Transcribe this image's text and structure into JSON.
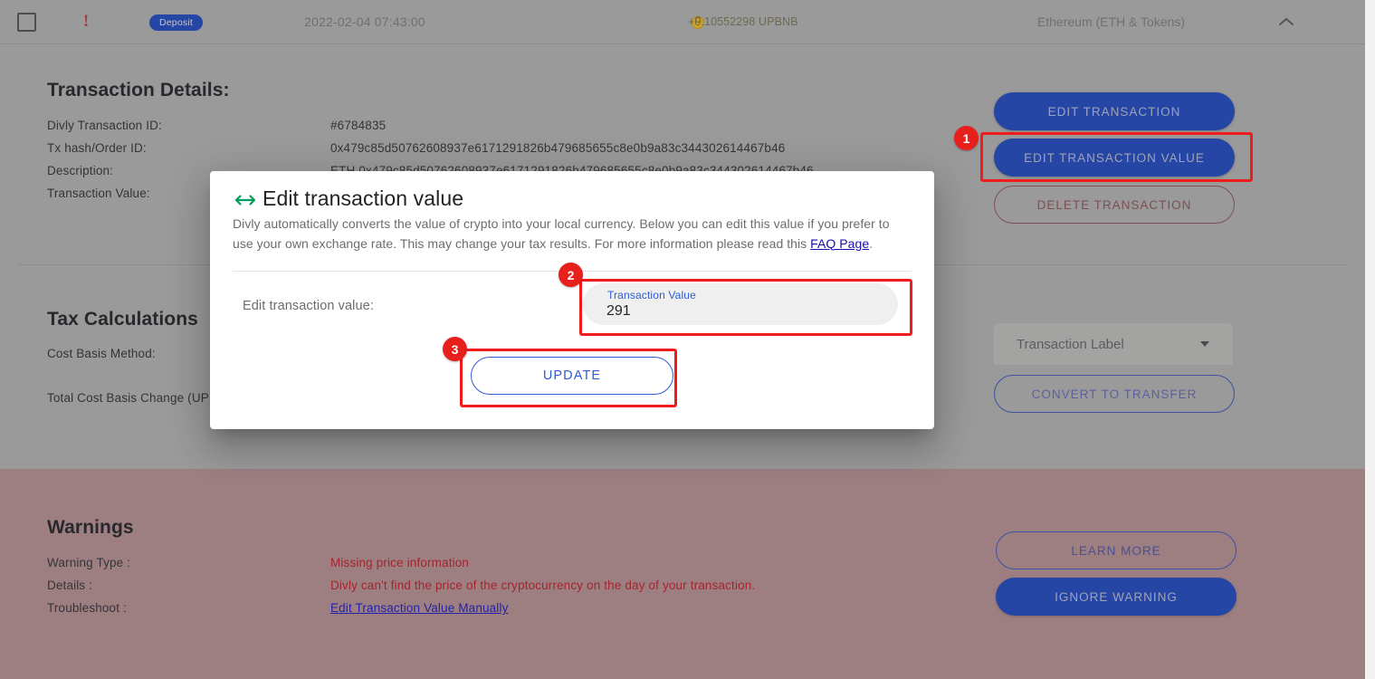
{
  "colors": {
    "page_grey": "#9a9a9a",
    "warning_panel": "#9d7f82",
    "primary_blue": "#2646a5",
    "link_blue": "#2b5cdb",
    "warning_red": "#a5242c",
    "annotation_red": "#f21b1b",
    "coin_gold": "#c9a227",
    "modal_icon_green": "#00a05a"
  },
  "top_row": {
    "checkbox_name": "checkbox-unchecked",
    "warning_icon": "!",
    "type_badge": "Deposit",
    "datetime": "2022-02-04 07:43:00",
    "amount": "+0.10552298 UPBNB",
    "coin_icon": "coin-icon",
    "chain": "Ethereum (ETH & Tokens)",
    "collapse_icon": "chevron-up-icon"
  },
  "transaction_details": {
    "title": "Transaction Details:",
    "rows": [
      {
        "label": "Divly Transaction ID:",
        "value": "#6784835"
      },
      {
        "label": "Tx hash/Order ID:",
        "value": "0x479c85d50762608937e6171291826b479685655c8e0b9a83c344302614467b46"
      },
      {
        "label": "Description:",
        "value": "ETH 0x479c85d50762608937e6171291826b479685655c8e0b9a83c344302614467b46"
      },
      {
        "label": "Transaction Value:",
        "value": ""
      }
    ],
    "buttons": {
      "edit_transaction": "EDIT TRANSACTION",
      "edit_transaction_value": "EDIT TRANSACTION VALUE",
      "delete_transaction": "DELETE TRANSACTION"
    }
  },
  "tax_calculations": {
    "title": "Tax Calculations",
    "rows": [
      {
        "label": "Cost Basis Method:",
        "value": ""
      },
      {
        "label": "Total Cost Basis Change (UP",
        "value": ""
      }
    ],
    "label_select": {
      "value": "Transaction Label",
      "caret_icon": "chevron-down-icon"
    },
    "buttons": {
      "convert_to_transfer": "CONVERT TO TRANSFER"
    }
  },
  "warnings": {
    "title": "Warnings",
    "rows": [
      {
        "label": "Warning Type :",
        "value": "Missing price information",
        "kind": "text"
      },
      {
        "label": "Details :",
        "value": "Divly can't find the price of the cryptocurrency on the day of your transaction.",
        "kind": "text"
      },
      {
        "label": "Troubleshoot :",
        "value": "Edit Transaction Value Manually",
        "kind": "link"
      }
    ],
    "buttons": {
      "learn_more": "LEARN MORE",
      "ignore_warning": "IGNORE WARNING"
    }
  },
  "modal": {
    "icon": "horizontal-arrows-icon",
    "title": "Edit transaction value",
    "description_part1": "Divly automatically converts the value of crypto into your local currency. Below you can edit this value if you prefer to use your own exchange rate. This may change your tax results. For more information please read this ",
    "description_link": "FAQ Page",
    "description_part2": ".",
    "field_caption": "Edit transaction value:",
    "input": {
      "label": "Transaction Value",
      "value": "291",
      "placeholder": "Transaction Value"
    },
    "update_button": "UPDATE"
  },
  "annotations": [
    {
      "number": "1",
      "target": "edit-transaction-value-button"
    },
    {
      "number": "2",
      "target": "transaction-value-input"
    },
    {
      "number": "3",
      "target": "update-button"
    }
  ]
}
